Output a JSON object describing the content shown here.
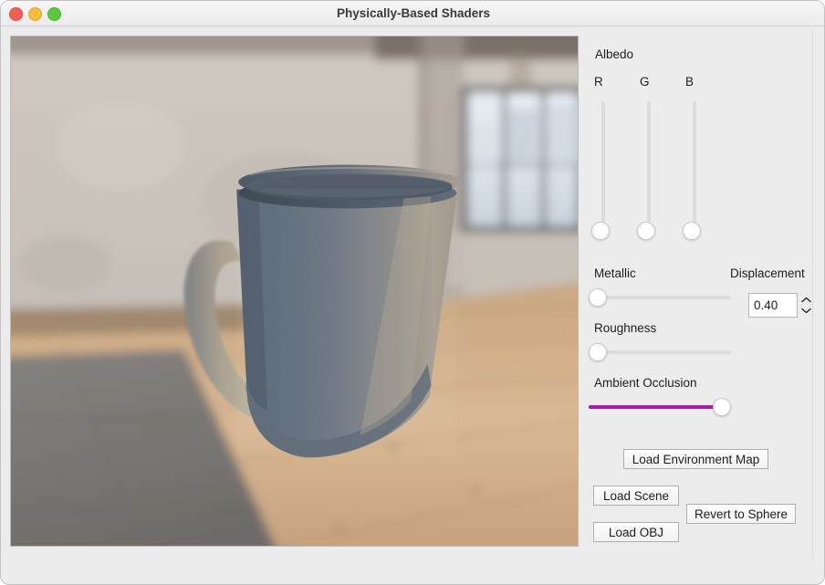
{
  "window": {
    "title": "Physically-Based Shaders",
    "traffic_lights": [
      {
        "name": "close",
        "color": "#ef5f56"
      },
      {
        "name": "minimize",
        "color": "#f6bd3b"
      },
      {
        "name": "maximize",
        "color": "#5cc840"
      }
    ]
  },
  "viewport": {
    "name": "3d-render-viewport",
    "description": "Rendered 3D mug on blurred indoor environment map"
  },
  "panel": {
    "albedo": {
      "label": "Albedo",
      "channels": [
        {
          "name": "R",
          "label": "R",
          "value": 0.0
        },
        {
          "name": "G",
          "label": "G",
          "value": 0.0
        },
        {
          "name": "B",
          "label": "B",
          "value": 0.0
        }
      ]
    },
    "metallic": {
      "label": "Metallic",
      "value": 0.0
    },
    "roughness": {
      "label": "Roughness",
      "value": 0.0
    },
    "ambient_occlusion": {
      "label": "Ambient Occlusion",
      "value": 0.94,
      "fill_color": "#A81EA8"
    },
    "displacement": {
      "label": "Displacement",
      "value": "0.40"
    },
    "buttons": {
      "load_environment_map": "Load Environment Map",
      "load_scene": "Load Scene",
      "revert_to_sphere": "Revert to Sphere",
      "load_obj": "Load OBJ"
    }
  }
}
